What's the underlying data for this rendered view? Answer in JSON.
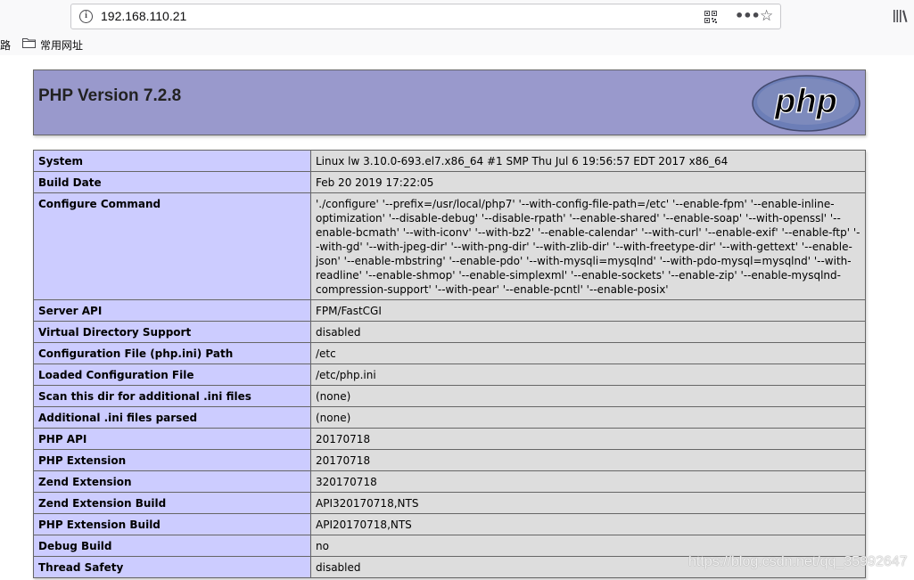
{
  "browser": {
    "url": "192.168.110.21",
    "bookmark_cut_label": "路",
    "bookmark_folder_label": "常用网址"
  },
  "php": {
    "title": "PHP Version 7.2.8",
    "logo_text": "php",
    "rows": [
      {
        "key": "System",
        "value": "Linux lw 3.10.0-693.el7.x86_64 #1 SMP Thu Jul 6 19:56:57 EDT 2017 x86_64"
      },
      {
        "key": "Build Date",
        "value": "Feb 20 2019 17:22:05"
      },
      {
        "key": "Configure Command",
        "value": "'./configure' '--prefix=/usr/local/php7' '--with-config-file-path=/etc' '--enable-fpm' '--enable-inline-optimization' '--disable-debug' '--disable-rpath' '--enable-shared' '--enable-soap' '--with-openssl' '--enable-bcmath' '--with-iconv' '--with-bz2' '--enable-calendar' '--with-curl' '--enable-exif' '--enable-ftp' '--with-gd' '--with-jpeg-dir' '--with-png-dir' '--with-zlib-dir' '--with-freetype-dir' '--with-gettext' '--enable-json' '--enable-mbstring' '--enable-pdo' '--with-mysqli=mysqlnd' '--with-pdo-mysql=mysqlnd' '--with-readline' '--enable-shmop' '--enable-simplexml' '--enable-sockets' '--enable-zip' '--enable-mysqlnd-compression-support' '--with-pear' '--enable-pcntl' '--enable-posix'"
      },
      {
        "key": "Server API",
        "value": "FPM/FastCGI"
      },
      {
        "key": "Virtual Directory Support",
        "value": "disabled"
      },
      {
        "key": "Configuration File (php.ini) Path",
        "value": "/etc"
      },
      {
        "key": "Loaded Configuration File",
        "value": "/etc/php.ini"
      },
      {
        "key": "Scan this dir for additional .ini files",
        "value": "(none)"
      },
      {
        "key": "Additional .ini files parsed",
        "value": "(none)"
      },
      {
        "key": "PHP API",
        "value": "20170718"
      },
      {
        "key": "PHP Extension",
        "value": "20170718"
      },
      {
        "key": "Zend Extension",
        "value": "320170718"
      },
      {
        "key": "Zend Extension Build",
        "value": "API320170718,NTS"
      },
      {
        "key": "PHP Extension Build",
        "value": "API20170718,NTS"
      },
      {
        "key": "Debug Build",
        "value": "no"
      },
      {
        "key": "Thread Safety",
        "value": "disabled"
      }
    ]
  },
  "watermark": "https://blog.csdn.net/qq_35992647",
  "colors": {
    "header_bg": "#9999cc",
    "key_bg": "#ccccff",
    "value_bg": "#dddddd"
  }
}
